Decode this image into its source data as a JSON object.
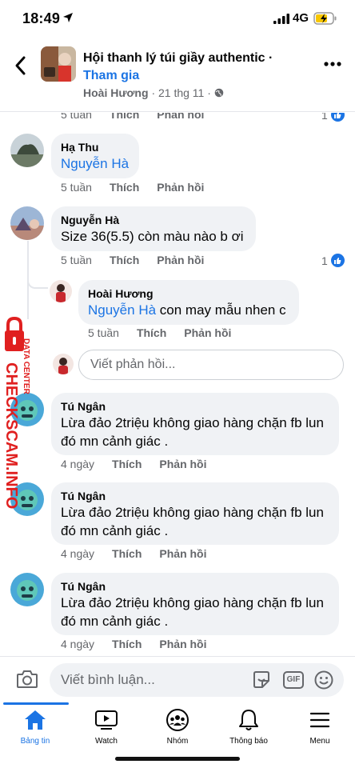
{
  "status": {
    "time": "18:49",
    "network": "4G"
  },
  "header": {
    "group_name": "Hội thanh lý túi giầy authentic ·",
    "join_label": "Tham gia",
    "author": "Hoài Hương",
    "date": "· 21 thg 11 ·"
  },
  "top_row": {
    "time": "5 tuần",
    "like": "Thích",
    "reply": "Phản hồi",
    "react_count": "1"
  },
  "comments": [
    {
      "author": "Hạ Thu",
      "mention": "Nguyễn Hà",
      "text": "",
      "time": "5 tuần",
      "like": "Thích",
      "reply": "Phản hồi"
    },
    {
      "author": "Nguyễn Hà",
      "text": "Size 36(5.5) còn màu nào b ơi",
      "time": "5 tuần",
      "like": "Thích",
      "reply": "Phản hồi",
      "react_count": "1"
    },
    {
      "author": "Hoài Hương",
      "mention": "Nguyễn Hà",
      "text": " con may mẫu nhen c",
      "time": "5 tuần",
      "like": "Thích",
      "reply": "Phản hồi"
    },
    {
      "author": "Tú Ngân",
      "text_line1": "Lừa đảo 2triệu không giao hàng chặn fb lun",
      "text_line2": "đó mn cảnh giác .",
      "time": "4 ngày",
      "like": "Thích",
      "reply": "Phản hồi"
    },
    {
      "author": "Tú Ngân",
      "text_line1": "Lừa đảo 2triệu không giao hàng chặn fb lun",
      "text_line2": "đó mn cảnh giác .",
      "time": "4 ngày",
      "like": "Thích",
      "reply": "Phản hồi"
    },
    {
      "author": "Tú Ngân",
      "text_line1": "Lừa đảo 2triệu không giao hàng chặn fb lun",
      "text_line2": "đó mn cảnh giác .",
      "time": "4 ngày",
      "like": "Thích",
      "reply": "Phản hồi"
    }
  ],
  "reply_box": {
    "placeholder": "Viết phản hồi..."
  },
  "watermark": {
    "brand": "CHECKSCAM.INFO",
    "tag": "DATA CENTER"
  },
  "composer": {
    "placeholder": "Viết bình luận...",
    "gif": "GIF"
  },
  "tabs": [
    {
      "label": "Bảng tin",
      "icon": "home-icon",
      "active": true
    },
    {
      "label": "Watch",
      "icon": "watch-icon"
    },
    {
      "label": "Nhóm",
      "icon": "groups-icon"
    },
    {
      "label": "Thông báo",
      "icon": "bell-icon"
    },
    {
      "label": "Menu",
      "icon": "menu-icon"
    }
  ],
  "colors": {
    "accent": "#1b74e4",
    "bubble": "#f0f2f5",
    "muted": "#65676b",
    "watermark": "#e02020"
  }
}
